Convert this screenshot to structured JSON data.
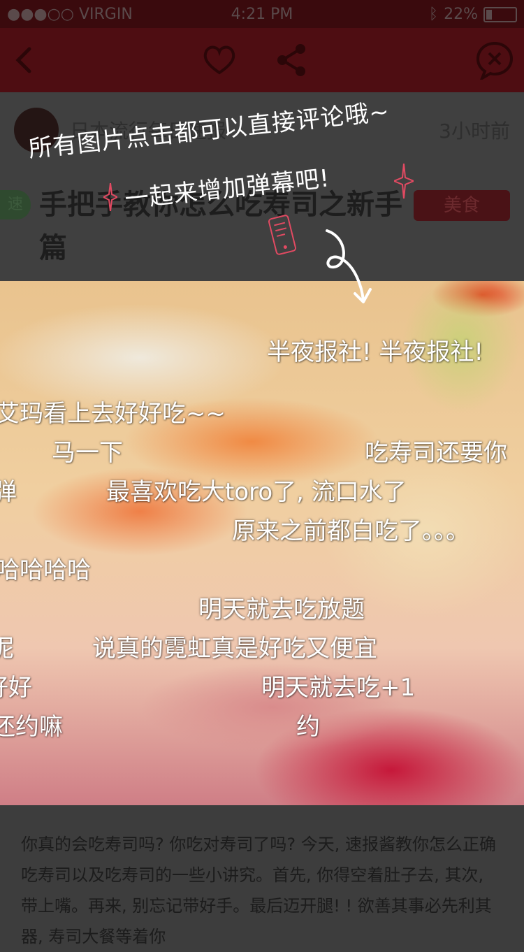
{
  "status_bar": {
    "carrier": "●●●○○ VIRGIN",
    "time": "4:21 PM",
    "battery": "22%"
  },
  "nav": {
    "icons": [
      "back-arrow-icon",
      "heart-icon",
      "share-icon",
      "close-comment-icon"
    ]
  },
  "post": {
    "author": "日本流行每日速报",
    "time_ago": "3小时前",
    "badge": "速",
    "title": "手把手教你怎么吃寿司之新手篇",
    "category": "美食"
  },
  "hint": {
    "line1": "所有图片点击都可以直接评论哦~",
    "line2": "一起来增加弹幕吧!"
  },
  "danmaku": [
    "半夜报社! 半夜报社!",
    "艾玛看上去好好吃~~",
    "马一下",
    "吃寿司还要你",
    "弹",
    "最喜欢吃大toro了, 流口水了",
    "原来之前都白吃了。。。",
    "哈哈哈哈",
    "明天就去吃放题",
    "呢",
    "说真的霓虹真是好吃又便宜",
    "好好",
    "明天就去吃+1",
    "还约嘛",
    "约"
  ],
  "article": {
    "text": "你真的会吃寿司吗? 你吃对寿司了吗? 今天, 速报酱教你怎么正确吃寿司以及吃寿司的一些小讲究。首先, 你得空着肚子去, 其次, 带上嘴。再来, 别忘记带好手。最后迈开腿! ! 欲善其事必先利其器, 寿司大餐等着你"
  }
}
